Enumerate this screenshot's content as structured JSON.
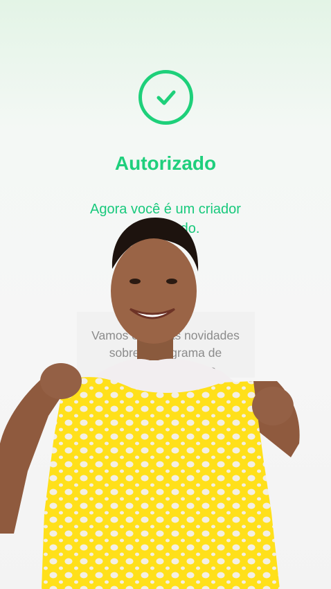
{
  "status": {
    "icon": "check-circle-icon",
    "title": "Autorizado",
    "subtitle_line1": "Agora você é um criador",
    "subtitle_line2": "autorizado."
  },
  "info": {
    "line1": "Vamos enviar as novidades",
    "line2": "sobre o programa de",
    "line3": "criadores no grupo"
  },
  "colors": {
    "accent": "#1fcf7c",
    "info_text": "#8b8b8b",
    "crochet": "#ffe01a"
  },
  "overlay": {
    "icon": "creator-video-overlay"
  }
}
